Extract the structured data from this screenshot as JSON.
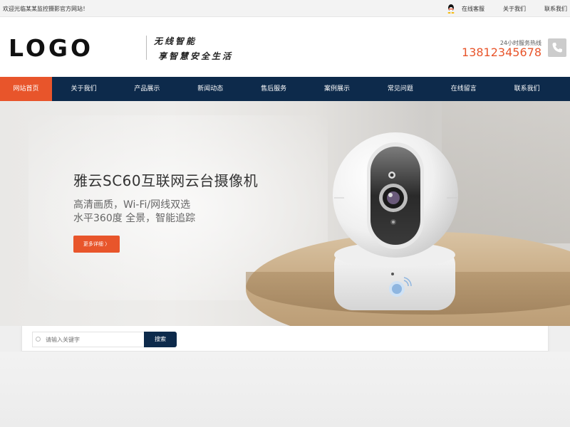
{
  "topbar": {
    "welcome": "欢迎光临某某监控摄影官方网站！",
    "links": [
      "在线客服",
      "关于我们",
      "联系我们"
    ]
  },
  "header": {
    "logo": "LOGO",
    "slogan_line1": "无线智能",
    "slogan_line2": "享智慧安全生活",
    "hotline_label": "24小时服务热线",
    "hotline_number": "13812345678"
  },
  "nav": {
    "items": [
      "网站首页",
      "关于我们",
      "产品展示",
      "新闻动态",
      "售后服务",
      "案例展示",
      "常见问题",
      "在线留言",
      "联系我们"
    ]
  },
  "banner": {
    "title": "雅云SC60互联网云台摄像机",
    "subtitle_line1": "高清画质，Wi-Fi/网线双选",
    "subtitle_line2": "水平360度 全景，智能追踪",
    "more_button": "更多详细 〉"
  },
  "search": {
    "placeholder": "请输入关键字",
    "button": "搜索"
  },
  "colors": {
    "accent": "#e8552b",
    "nav_bg": "#0d2a4b"
  },
  "icons": [
    "qq-icon",
    "phone-icon",
    "search-icon"
  ]
}
